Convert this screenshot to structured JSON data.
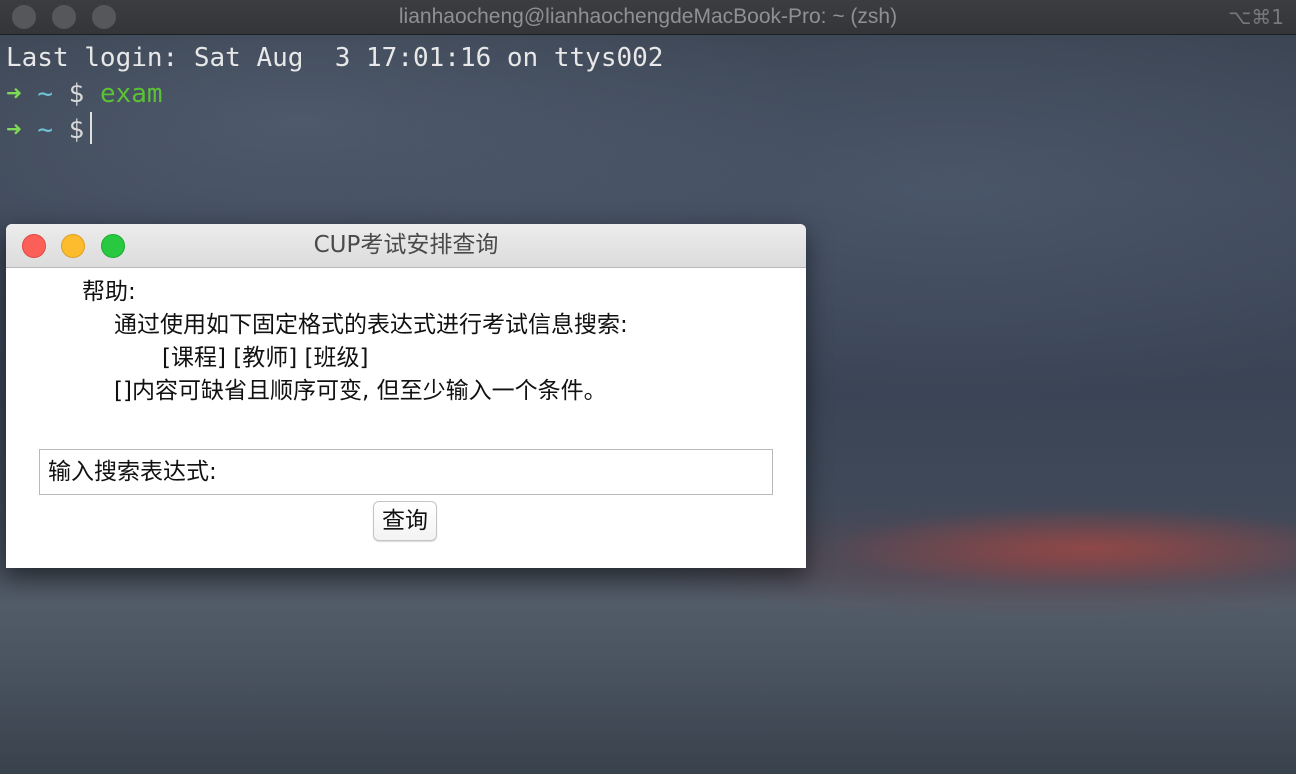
{
  "terminal": {
    "title": "lianhaocheng@lianhaochengdeMacBook-Pro: ~ (zsh)",
    "shortcut": "⌥⌘1",
    "last_login": "Last login: Sat Aug  3 17:01:16 on ttys002",
    "prompt_arrow": "➜",
    "prompt_dir": "~",
    "prompt_symbol": "$",
    "command": "exam"
  },
  "app": {
    "title": "CUP考试安排查询",
    "help_heading": "帮助:",
    "help_desc": "通过使用如下固定格式的表达式进行考试信息搜索:",
    "help_format": "[课程] [教师] [班级]",
    "help_note": "[]内容可缺省且顺序可变, 但至少输入一个条件。",
    "search_label": "输入搜索表达式:",
    "query_button": "查询"
  },
  "colors": {
    "close": "#fc5f57",
    "minimize": "#fdbc2e",
    "maximize": "#28c840",
    "prompt_arrow": "#7ed957",
    "prompt_dir": "#6fc3d6",
    "command": "#5bc236"
  }
}
